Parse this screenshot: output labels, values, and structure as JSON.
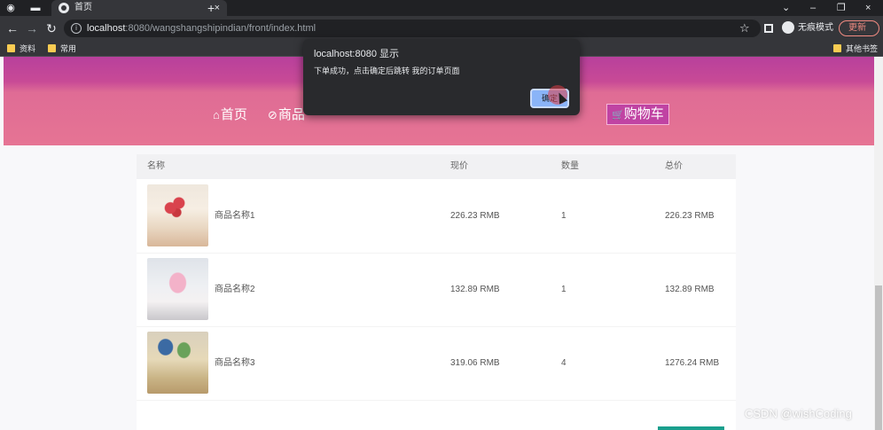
{
  "browser": {
    "tab_title": "首页",
    "tab_close": "×",
    "new_tab": "+",
    "url_host": "localhost",
    "url_rest": ":8080/wangshangshipindian/front/index.html",
    "incognito_label": "无痕模式",
    "update_label": "更新",
    "win_min": "–",
    "win_max": "❐",
    "win_close": "×",
    "win_chevron": "⌄",
    "icons": [
      "back-arrow-icon",
      "forward-arrow-icon",
      "reload-icon",
      "info-icon",
      "star-icon",
      "side-panel-icon",
      "incognito-icon"
    ]
  },
  "bookmarks": {
    "items": [
      "资料",
      "常用"
    ],
    "other": "其他书签"
  },
  "header": {
    "nav": [
      {
        "icon": "⌂",
        "label": "首页"
      },
      {
        "icon": "⊘",
        "label": "商品"
      }
    ],
    "cart": {
      "icon": "🛒",
      "label": "购物车"
    }
  },
  "cart": {
    "columns": [
      "名称",
      "现价",
      "数量",
      "总价"
    ],
    "rows": [
      {
        "name": "商品名称1",
        "price": "226.23 RMB",
        "qty": "1",
        "total": "226.23 RMB"
      },
      {
        "name": "商品名称2",
        "price": "132.89 RMB",
        "qty": "1",
        "total": "132.89 RMB"
      },
      {
        "name": "商品名称3",
        "price": "319.06 RMB",
        "qty": "4",
        "total": "1276.24 RMB"
      }
    ]
  },
  "dialog": {
    "title": "localhost:8080 显示",
    "message": "下单成功，点击确定后跳转 我的订单页面",
    "ok_label": "确定"
  },
  "watermark": "CSDN @wishCoding",
  "colors": {
    "header_top": "#b8409c",
    "header_bottom": "#e67494",
    "cart_button": "#c043a3",
    "dialog_bg": "#292a2d",
    "dialog_button": "#8ab4f8"
  }
}
